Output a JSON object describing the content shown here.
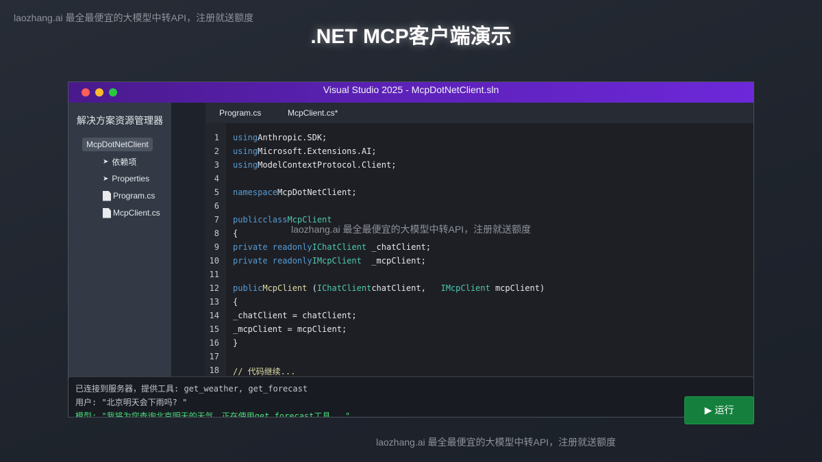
{
  "watermark": "laozhang.ai 最全最便宜的大模型中转API，注册就送额度",
  "page_title": ".NET MCP客户端演示",
  "window": {
    "title": "Visual Studio 2025 - McpDotNetClient.sln"
  },
  "sidebar": {
    "title": "解决方案资源管理器",
    "project": "McpDotNetClient",
    "items": [
      {
        "label": "依赖项",
        "icon": "chevron-right-icon"
      },
      {
        "label": "Properties",
        "icon": "chevron-right-icon"
      },
      {
        "label": "Program.cs",
        "icon": "file-icon"
      },
      {
        "label": "McpClient.cs",
        "icon": "file-icon"
      }
    ]
  },
  "tabs": [
    {
      "label": "Program.cs"
    },
    {
      "label": "McpClient.cs*"
    }
  ],
  "editor": {
    "line_numbers": [
      "1",
      "2",
      "3",
      "4",
      "5",
      "6",
      "7",
      "8",
      "9",
      "10",
      "11",
      "12",
      "13",
      "14",
      "15",
      "16",
      "17",
      "18"
    ],
    "tokens": {
      "using": "using",
      "anthropic_sdk": "Anthropic.SDK;",
      "ms_ext_ai": "Microsoft.Extensions.AI;",
      "mcp_client_ns": "ModelContextProtocol.Client;",
      "namespace": "namespace",
      "namespace_name": "McpDotNetClient;",
      "public": "public",
      "class": "class",
      "class_name": "McpClient",
      "open_brace": "{",
      "close_brace": "}",
      "private_readonly": "private readonly",
      "ichatclient": "IChatClient",
      "chat_field": " _chatClient;",
      "imcpclient": "IMcpClient",
      "mcp_field": "  _mcpClient;",
      "ctor_name": "McpClient",
      "ctor_open": " (",
      "ctor_param1": "chatClient,   ",
      "ctor_param2": " mcpClient)",
      "assign1": "_chatClient = chatClient;",
      "assign2": "_mcpClient = mcpClient;",
      "comment": "// 代码继续..."
    }
  },
  "console": {
    "lines": [
      "已连接到服务器，提供工具: get_weather, get_forecast",
      "用户: \"北京明天会下雨吗? \"",
      "模型: \"我将为您查询北京明天的天气。正在使用get_forecast工具...\""
    ]
  },
  "run_button": {
    "icon": "play-icon",
    "label": "▶ 运行"
  }
}
